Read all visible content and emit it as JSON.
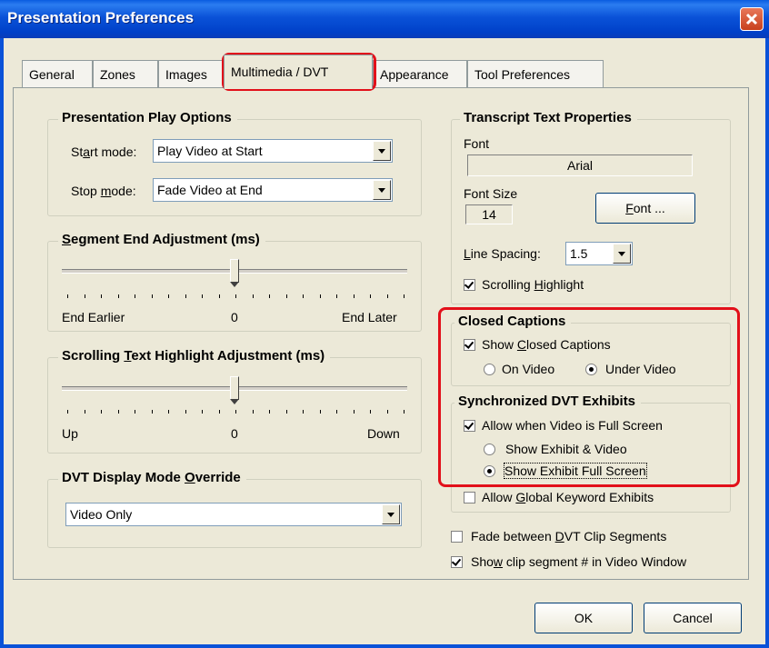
{
  "window": {
    "title": "Presentation Preferences"
  },
  "tabs": [
    {
      "label": "General"
    },
    {
      "label": "Zones"
    },
    {
      "label": "Images"
    },
    {
      "label": "Multimedia / DVT",
      "active": true
    },
    {
      "label": "Appearance"
    },
    {
      "label": "Tool Preferences"
    }
  ],
  "play_options": {
    "title": "Presentation Play Options",
    "start_label_pre": "St",
    "start_label_u": "a",
    "start_label_post": "rt mode:",
    "start_value": "Play Video at Start",
    "stop_label_pre": "Stop ",
    "stop_label_u": "m",
    "stop_label_post": "ode:",
    "stop_value": "Fade Video at End"
  },
  "segment_end": {
    "title_u": "S",
    "title_rest": "egment End Adjustment (ms)",
    "min_label": "End Earlier",
    "mid_label": "0",
    "max_label": "End Later",
    "value": 0
  },
  "scroll_highlight": {
    "title_pre": "Scrolling ",
    "title_u": "T",
    "title_rest": "ext Highlight Adjustment (ms)",
    "min_label": "Up",
    "mid_label": "0",
    "max_label": "Down",
    "value": 0
  },
  "dvt_mode": {
    "title_pre": "DVT Display Mode ",
    "title_u": "O",
    "title_rest": "verride",
    "value": "Video Only"
  },
  "transcript": {
    "title": "Transcript Text Properties",
    "font_label": "Font",
    "font_value": "Arial",
    "font_size_label": "Font Size",
    "font_size_value": "14",
    "font_button_u": "F",
    "font_button_rest": "ont ...",
    "line_spacing_u": "L",
    "line_spacing_rest": "ine Spacing:",
    "line_spacing_value": "1.5",
    "scrolling_highlight_pre": "Scrolling ",
    "scrolling_highlight_u": "H",
    "scrolling_highlight_rest": "ighlight",
    "scrolling_highlight_checked": true
  },
  "closed_captions": {
    "title": "Closed Captions",
    "show_pre": "Show ",
    "show_u": "C",
    "show_rest": "losed Captions",
    "show_checked": true,
    "on_video": "On Video",
    "under_video": "Under Video",
    "selected": "Under Video"
  },
  "dvt_exhibits": {
    "title": "Synchronized DVT Exhibits",
    "allow_full_screen": "Allow when Video is Full Screen",
    "allow_full_screen_checked": true,
    "show_exhibit_video": "Show Exhibit & Video",
    "show_exhibit_full": "Show Exhibit Full Screen",
    "selected": "Show Exhibit Full Screen",
    "global_pre": "Allow ",
    "global_u": "G",
    "global_rest": "lobal Keyword Exhibits",
    "global_checked": false
  },
  "options": {
    "fade_pre": "Fade between ",
    "fade_u": "D",
    "fade_rest": "VT Clip Segments",
    "fade_checked": false,
    "show_clip_pre": "Sho",
    "show_clip_u": "w",
    "show_clip_rest": " clip segment # in Video Window",
    "show_clip_checked": true
  },
  "buttons": {
    "ok": "OK",
    "cancel": "Cancel"
  },
  "colors": {
    "highlight": "#e2101a",
    "titlebar": "#0a52d8",
    "face": "#ece9d8"
  }
}
